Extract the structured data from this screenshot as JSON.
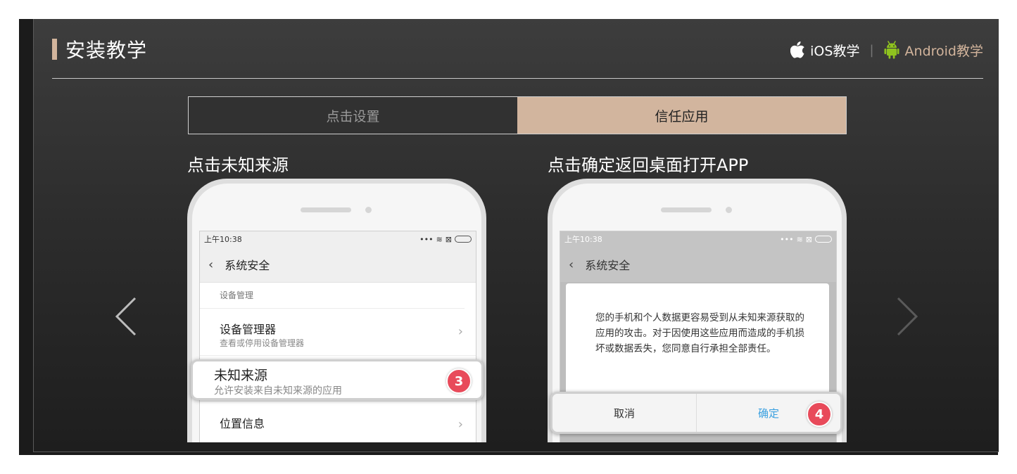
{
  "header": {
    "title": "安装教学",
    "ios_label": "iOS教学",
    "separator": "|",
    "android_label": "Android教学"
  },
  "tabs": [
    {
      "label": "点击设置",
      "active": false
    },
    {
      "label": "信任应用",
      "active": true
    }
  ],
  "steps": [
    {
      "label": "点击未知来源",
      "status_time": "上午10:38",
      "nav_title": "系统安全",
      "section_header": "设备管理",
      "items": [
        {
          "title": "设备管理器",
          "subtitle": "查看或停用设备管理器"
        },
        {
          "title": "未知来源",
          "subtitle": "允许安装来自未知来源的应用"
        },
        {
          "title": "位置信息"
        }
      ],
      "badge": "3"
    },
    {
      "label": "点击确定返回桌面打开APP",
      "status_time": "上午10:38",
      "nav_title": "系统安全",
      "dialog_text": "您的手机和个人数据更容易受到从未知来源获取的应用的攻击。对于因使用这些应用而造成的手机损坏或数据丢失，您同意自行承担全部责任。",
      "cancel_label": "取消",
      "confirm_label": "确定",
      "badge": "4"
    }
  ],
  "colors": {
    "accent": "#d2b49c",
    "badge": "#e84a5a",
    "confirm": "#3aa0e0"
  }
}
